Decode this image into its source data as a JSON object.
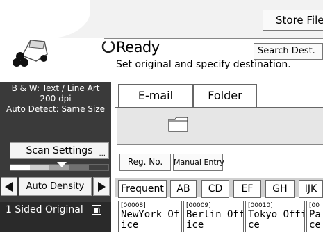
{
  "header": {
    "store_file_label": "Store File",
    "status": "Ready",
    "search_dest_label": "Search Dest.",
    "message": "Set original and specify destination."
  },
  "scan_info": {
    "line1": "B & W: Text / Line Art",
    "line2": "200 dpi",
    "line3": "Auto Detect: Same Size"
  },
  "scan_settings": {
    "label": "Scan Settings"
  },
  "density": {
    "label": "Auto Density"
  },
  "original": {
    "label": "1 Sided Original"
  },
  "tabs": [
    {
      "label": "E-mail",
      "selected": false
    },
    {
      "label": "Folder",
      "selected": true
    }
  ],
  "buttons": {
    "reg_no": "Reg. No.",
    "manual_entry": "Manual Entry"
  },
  "index_tabs": [
    "Frequent",
    "AB",
    "CD",
    "EF",
    "GH",
    "IJK"
  ],
  "destinations": [
    {
      "number": "[00008]",
      "line1": "NewYork Of",
      "line2": "ice"
    },
    {
      "number": "[00009]",
      "line1": "Berlin Off",
      "line2": "ice"
    },
    {
      "number": "[00010]",
      "line1": "Tokyo Offi",
      "line2": "ce"
    },
    {
      "number": "[00",
      "line1": "Pa",
      "line2": "ce"
    }
  ],
  "icons": {
    "logo": "scanner-logo-icon",
    "status": "spinner-icon",
    "folder": "folder-icon",
    "prev": "triangle-left-icon",
    "next": "triangle-right-icon",
    "original": "original-orientation-icon"
  },
  "colors": {
    "panel_dark": "#3a3a3a",
    "panel_darker": "#2a2a2a",
    "destination_area": "#e6e6e6",
    "index_row": "#d0d0d0"
  }
}
